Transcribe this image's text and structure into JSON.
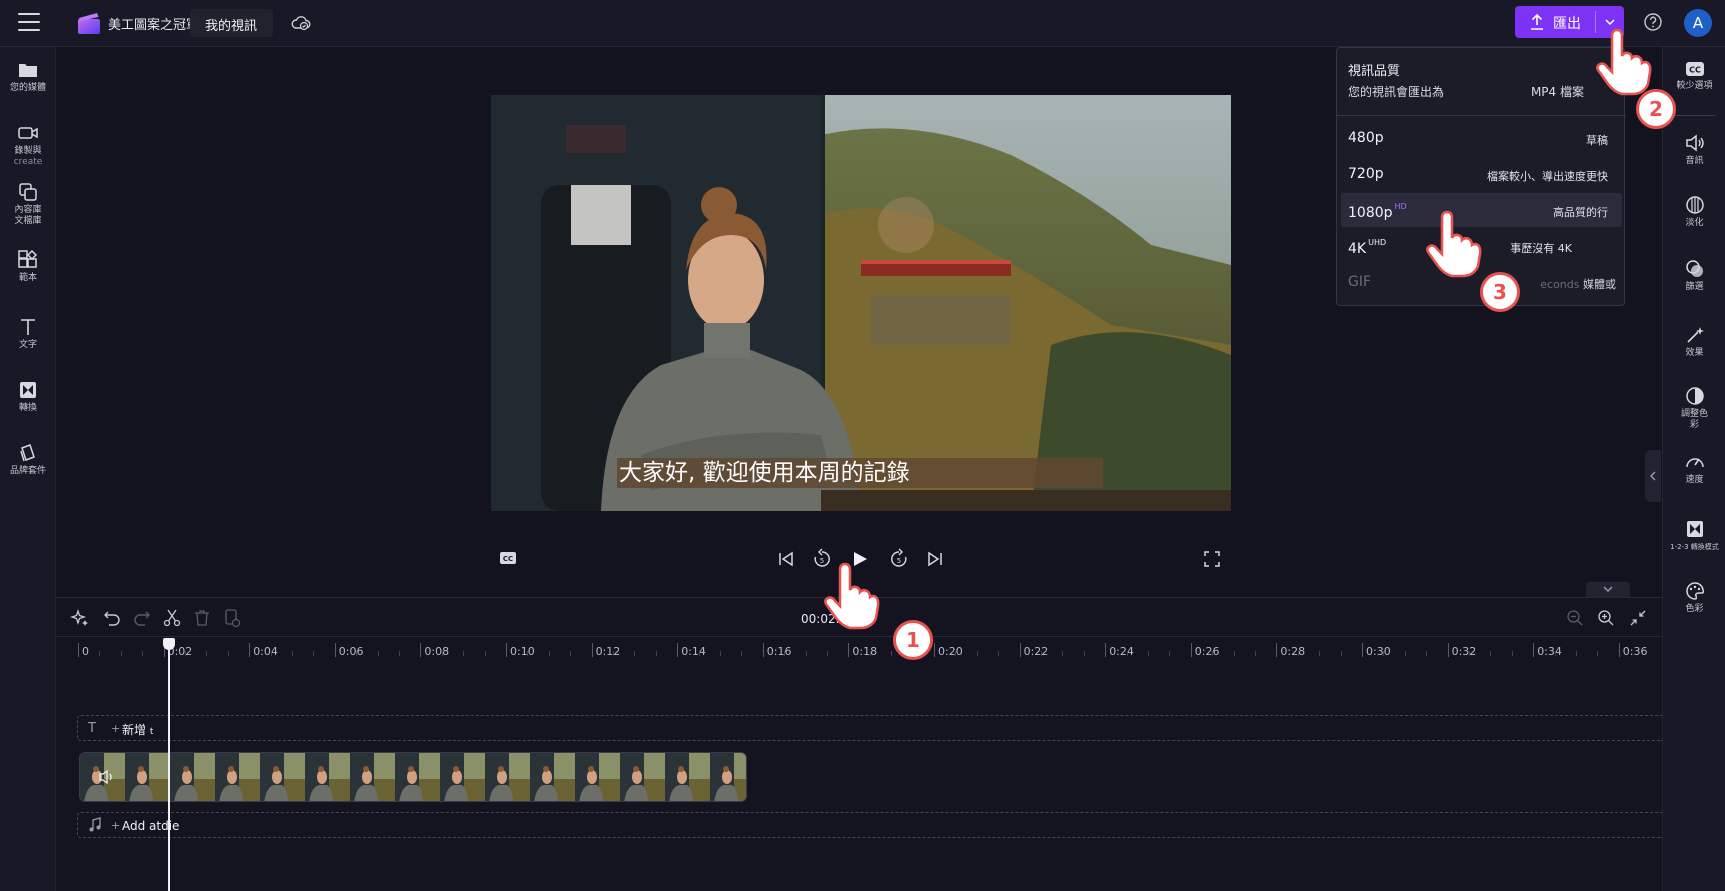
{
  "header": {
    "brand": "美工圖案之冠軍",
    "project_name": "我的視訊",
    "export_label": "匯出",
    "avatar_initial": "A",
    "accent_color": "#7c33f5"
  },
  "left_rail": [
    {
      "label": "您的媒體",
      "icon": "folder-icon"
    },
    {
      "label": "錄製與",
      "sub": "create",
      "icon": "camera-icon"
    },
    {
      "label": "內容庫文檔庫",
      "icon": "content-library-icon"
    },
    {
      "label": "範本",
      "icon": "templates-icon"
    },
    {
      "label": "文字",
      "icon": "text-icon"
    },
    {
      "label": "轉換",
      "icon": "transitions-icon"
    },
    {
      "label": "品牌套件",
      "icon": "brand-kit-icon"
    }
  ],
  "right_rail": [
    {
      "label": "較少選項",
      "icon": "captions-icon"
    },
    {
      "label": "音訊",
      "icon": "audio-icon"
    },
    {
      "label": "淡化",
      "icon": "fade-icon"
    },
    {
      "label": "篩選",
      "icon": "filters-icon"
    },
    {
      "label": "效果",
      "icon": "effects-icon"
    },
    {
      "label": "調整色彩",
      "icon": "adjust-colors-icon"
    },
    {
      "label": "速度",
      "icon": "speed-icon"
    },
    {
      "label": "1-2-3 轉換模式",
      "icon": "transition-mode-icon"
    },
    {
      "label": "色彩",
      "icon": "color-palette-icon"
    }
  ],
  "preview": {
    "caption": "大家好, 歡迎使用本周的記錄"
  },
  "export_menu": {
    "title": "視訊品質",
    "subtitle": "您的視訊會匯出為",
    "format": "MP4 檔案",
    "options": [
      {
        "res": "480p",
        "sup": "",
        "desc": "草稿",
        "selected": false,
        "disabled": false
      },
      {
        "res": "720p",
        "sup": "",
        "desc": "檔案較小、導出速度更快",
        "selected": false,
        "disabled": false
      },
      {
        "res": "1080p",
        "sup": "HD",
        "desc": "高品質的行",
        "selected": true,
        "disabled": false
      },
      {
        "res": "4K",
        "sup": "UHD",
        "desc": "事歷沒有 4K",
        "selected": false,
        "disabled": false
      },
      {
        "res": "GIF",
        "sup": "",
        "desc_muted": "econds",
        "desc": "媒體或",
        "selected": false,
        "disabled": true
      }
    ]
  },
  "timeline": {
    "timecode": "00:02.",
    "ticks": [
      "0",
      "0:02",
      "0:04",
      "0:06",
      "0:08",
      "0:10",
      "0:12",
      "0:14",
      "0:16",
      "0:18",
      "0:20",
      "0:22",
      "0:24",
      "0:26",
      "0:28",
      "0:30",
      "0:32",
      "0:34",
      "0:36"
    ],
    "text_track_plus": "+",
    "text_track_label": "新增",
    "text_track_trailing": "t",
    "audio_track_plus": "+",
    "audio_track_label": "Add atdie"
  },
  "annotations": [
    "1",
    "2",
    "3"
  ]
}
